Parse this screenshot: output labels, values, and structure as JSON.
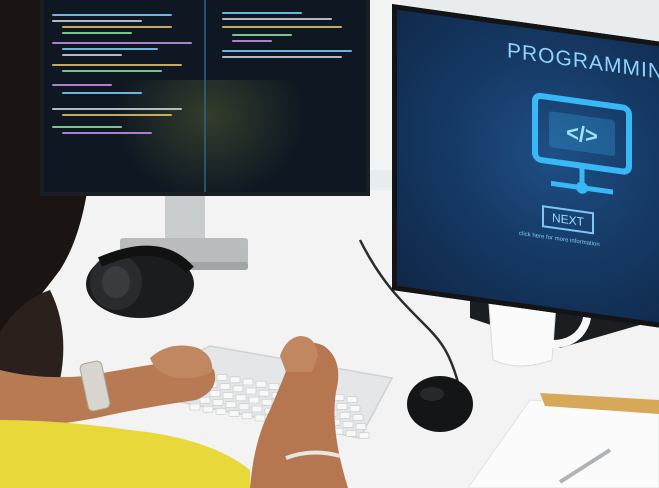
{
  "right_monitor": {
    "title": "PROGRAMMIN",
    "button_label": "NEXT",
    "hint": "click here for more information",
    "icon": "code-computer-icon"
  },
  "colors": {
    "screen_accent": "#7cc8f5",
    "screen_background": "#163a66",
    "shirt_yellow": "#e9d83a",
    "desk": "#eceeed"
  }
}
